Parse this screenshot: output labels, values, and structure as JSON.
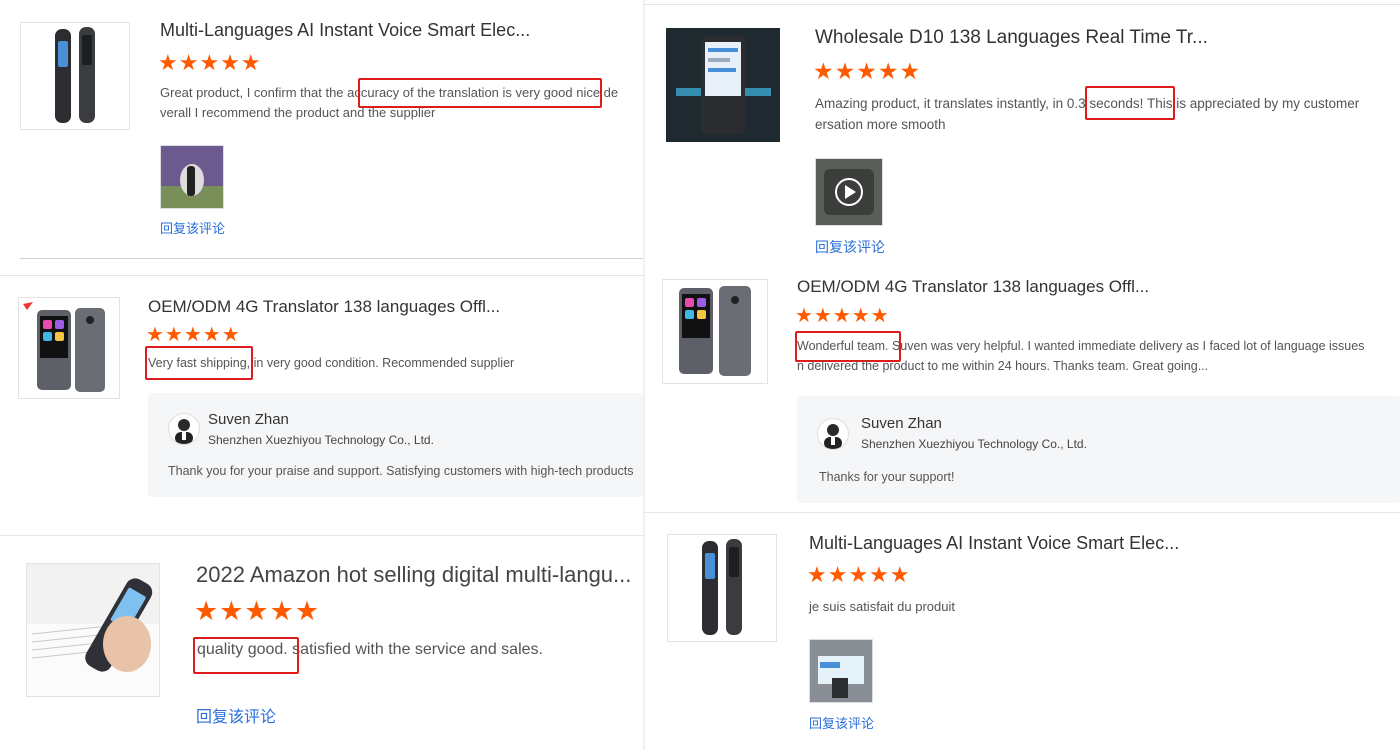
{
  "reviews": [
    {
      "product_title": "Multi-Languages AI Instant Voice Smart Elec...",
      "stars": "★★★★★",
      "text_before": "Great product, I confirm that the ",
      "text_highlight": "accuracy of the translation is very good",
      "text_after": " nice de",
      "text_line2": "verall I recommend the product and the supplier",
      "reply_link": "回复该评论"
    },
    {
      "product_title": "Wholesale D10 138 Languages Real Time Tr...",
      "stars": "★★★★★",
      "text_before": "Amazing product, it translates instantly, in ",
      "text_highlight": "0.3 seconds!",
      "text_after": " This is appreciated by my customer",
      "text_line2": "ersation more smooth",
      "reply_link": "回复该评论"
    },
    {
      "product_title": "OEM/ODM 4G Translator 138 languages Offl...",
      "stars": "★★★★★",
      "text_highlight": "Very fast shipping",
      "text_after": ", in very good condition. Recommended supplier",
      "seller_name": "Suven Zhan",
      "seller_company": "Shenzhen Xuezhiyou Technology Co., Ltd.",
      "seller_reply": "Thank you for your praise and support. Satisfying customers with high-tech products"
    },
    {
      "product_title": "OEM/ODM 4G Translator 138 languages Offl...",
      "stars": "★★★★★",
      "text_highlight": "Wonderful team.",
      "text_after": " Suven was very helpful. I wanted immediate delivery as I faced lot of language issues",
      "text_line2": "n delivered the product to me within 24 hours. Thanks team. Great going...",
      "seller_name": "Suven Zhan",
      "seller_company": "Shenzhen Xuezhiyou Technology Co., Ltd.",
      "seller_reply": "Thanks for your support!"
    },
    {
      "product_title": "2022 Amazon hot selling digital multi-langu...",
      "stars": "★★★★★",
      "text_highlight": "quality good.",
      "text_after": " satisfied with the service and sales.",
      "reply_link": "回复该评论"
    },
    {
      "product_title": "Multi-Languages AI Instant Voice Smart Elec...",
      "stars": "★★★★★",
      "text": "je suis satisfait du produit",
      "reply_link": "回复该评论"
    }
  ],
  "colors": {
    "star": "#ff5a00",
    "highlight_box": "#e01b1b",
    "link": "#2a6fdb"
  },
  "icons": [
    "translator-pen-image",
    "translator-device-image",
    "play-icon",
    "avatar-photo"
  ]
}
